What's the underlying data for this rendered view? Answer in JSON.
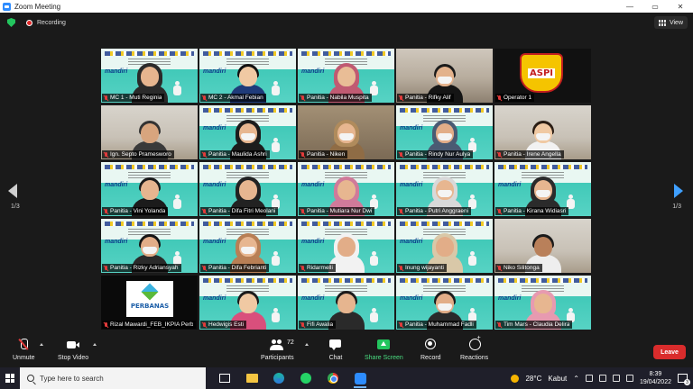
{
  "window": {
    "title": "Zoom Meeting",
    "buttons": [
      "—",
      "▭",
      "✕"
    ]
  },
  "meeting": {
    "recording_label": "Recording",
    "view_label": "View",
    "page_left": "1/3",
    "page_right": "1/3"
  },
  "participants": [
    {
      "label": "MC 1 - Muti Reginia",
      "bg": "stage",
      "person": "hijab",
      "skin": "#e6b58f",
      "hair": "#2a2a2a",
      "shirt": "#2a2a2a",
      "mask": false
    },
    {
      "label": "MC 2 - Akmal Febian",
      "bg": "stage",
      "person": "man",
      "skin": "#f0c9a3",
      "hair": "#111111",
      "shirt": "#1f3b7a",
      "mask": false
    },
    {
      "label": "Panitia - Nabila Muspita",
      "bg": "stage",
      "person": "hijab",
      "skin": "#e9bd96",
      "hair": "#c05a72",
      "shirt": "#c05a72",
      "mask": false
    },
    {
      "label": "Panitia - Rifky Alif",
      "bg": "office",
      "person": "man",
      "skin": "#e3b28c",
      "hair": "#1b1b1b",
      "shirt": "#151515",
      "mask": true
    },
    {
      "label": "Operator 1",
      "bg": "aspi",
      "person": "none",
      "skin": "",
      "hair": "",
      "shirt": "",
      "mask": false
    },
    {
      "label": "Ign. Septo Pramesworo",
      "bg": "room",
      "person": "man",
      "skin": "#d8a57e",
      "hair": "#333333",
      "shirt": "#3a3a3a",
      "mask": false
    },
    {
      "label": "Panitia - Maulida Ashri",
      "bg": "stage",
      "person": "hijab",
      "skin": "#e7b690",
      "hair": "#1c1c1c",
      "shirt": "#1c1c1c",
      "mask": true
    },
    {
      "label": "Panitia - Niken",
      "bg": "warm",
      "person": "hijab",
      "skin": "#e7b690",
      "hair": "#b08b5c",
      "shirt": "#8f6c45",
      "mask": true
    },
    {
      "label": "Panitia - Rindy Nur Aulya",
      "bg": "stage",
      "person": "hijab",
      "skin": "#e2ad88",
      "hair": "#4a5b73",
      "shirt": "#4a5b73",
      "mask": true
    },
    {
      "label": "Panitia - Irene Angella",
      "bg": "room",
      "person": "woman",
      "skin": "#f0c9a3",
      "hair": "#2a1d14",
      "shirt": "#f2f2f2",
      "mask": true
    },
    {
      "label": "Panitia - Vini Yolanda",
      "bg": "stage",
      "person": "woman",
      "skin": "#e6b58f",
      "hair": "#1b1b1b",
      "shirt": "#1b1b1b",
      "mask": false
    },
    {
      "label": "Panitia - Difa Fitri Meolani",
      "bg": "stage",
      "person": "hijab",
      "skin": "#e7b690",
      "hair": "#222222",
      "shirt": "#222222",
      "mask": false
    },
    {
      "label": "Panitia - Mutiara Nur Dwi",
      "bg": "stage",
      "person": "hijab",
      "skin": "#e7b690",
      "hair": "#d07a9a",
      "shirt": "#d07a9a",
      "mask": false
    },
    {
      "label": "Panitia - Putri Anggraeni",
      "bg": "stage",
      "person": "hijab",
      "skin": "#e7b690",
      "hair": "#d9d9d9",
      "shirt": "#d9d9d9",
      "mask": true
    },
    {
      "label": "Panitia - Kirana Widiasri",
      "bg": "stage",
      "person": "hijab",
      "skin": "#e7b690",
      "hair": "#2b2b2b",
      "shirt": "#2b2b2b",
      "mask": true
    },
    {
      "label": "Panitia - Rizky Adriansyah",
      "bg": "stage",
      "person": "man",
      "skin": "#e2ad88",
      "hair": "#151515",
      "shirt": "#2a2a2a",
      "mask": true
    },
    {
      "label": "Panitia - Difa Febrianti",
      "bg": "stage",
      "person": "hijab",
      "skin": "#e7b690",
      "hair": "#b87f55",
      "shirt": "#b87f55",
      "mask": true
    },
    {
      "label": "Ridarmelli",
      "bg": "stage",
      "person": "hijab",
      "skin": "#e2ad88",
      "hair": "#f2f2f2",
      "shirt": "#f2f2f2",
      "mask": false
    },
    {
      "label": "Inung wijayanti",
      "bg": "stage",
      "person": "hijab",
      "skin": "#e2ad88",
      "hair": "#d9c8a8",
      "shirt": "#d9c8a8",
      "mask": false
    },
    {
      "label": "Niko Silitonga",
      "bg": "room",
      "person": "man",
      "skin": "#b9805a",
      "hair": "#1a1a1a",
      "shirt": "#eeeeee",
      "mask": false
    },
    {
      "label": "Rizal Mawardi_FEB_IKPIA Perb...",
      "bg": "logo",
      "person": "none",
      "skin": "",
      "hair": "",
      "shirt": "",
      "mask": false
    },
    {
      "label": "Hedwigis Esti",
      "bg": "stage",
      "person": "woman",
      "skin": "#f0c9a3",
      "hair": "#1b1b1b",
      "shirt": "#d94f7c",
      "mask": false
    },
    {
      "label": "Fifi Awalia",
      "bg": "stage",
      "person": "woman",
      "skin": "#e6b58f",
      "hair": "#1b1b1b",
      "shirt": "#2a2a2a",
      "mask": false
    },
    {
      "label": "Panitia - Muhammad Fadli",
      "bg": "stage",
      "person": "man",
      "skin": "#e2ad88",
      "hair": "#1b1b1b",
      "shirt": "#2a2a2a",
      "mask": true
    },
    {
      "label": "Tim Mars - Claudia Delira",
      "bg": "stage",
      "person": "hijab",
      "skin": "#e7b690",
      "hair": "#e79ab0",
      "shirt": "#e79ab0",
      "mask": false
    }
  ],
  "logos": {
    "aspi": "ASPI",
    "perbanas": "PERBANAS",
    "stage_brand": "mandiri"
  },
  "toolbar": {
    "unmute": "Unmute",
    "stop_video": "Stop Video",
    "participants": "Participants",
    "participant_count": "72",
    "chat": "Chat",
    "share_screen": "Share Screen",
    "record": "Record",
    "reactions": "Reactions",
    "leave": "Leave"
  },
  "taskbar": {
    "search_placeholder": "Type here to search",
    "weather_temp": "28°C",
    "weather_text": "Kabut",
    "time": "8:39",
    "date": "19/04/2022",
    "notifications": "3"
  },
  "colors": {
    "accent": "#2d8cff",
    "leave": "#d92c2c",
    "share": "#23c55e",
    "muted": "#e23b3b"
  }
}
